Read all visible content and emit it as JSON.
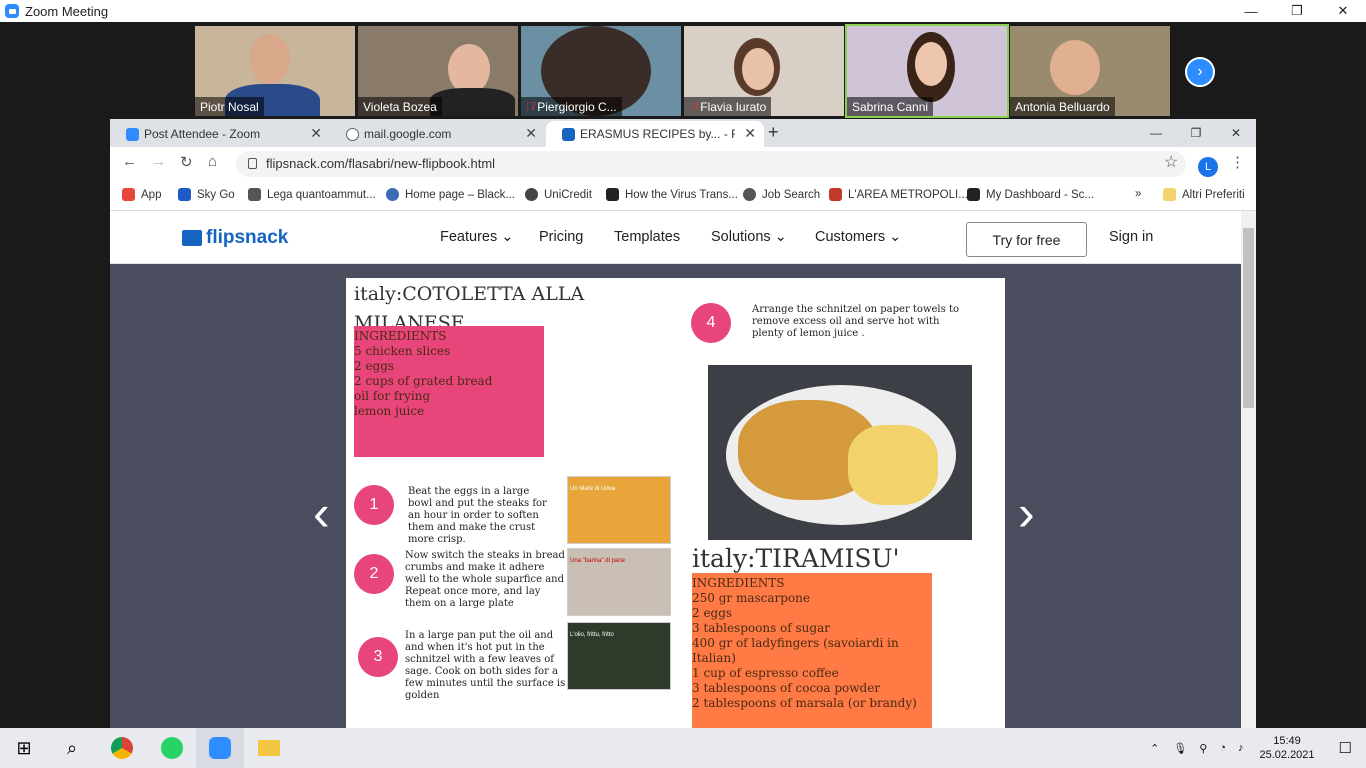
{
  "zoom": {
    "window_title": "Zoom Meeting",
    "controls": {
      "minimize": "—",
      "restore": "❐",
      "close": "✕"
    },
    "participants": [
      {
        "name": "Piotr Nosal",
        "muted": false
      },
      {
        "name": "Violeta Bozea",
        "muted": false
      },
      {
        "name": "Piergiorgio C...",
        "muted": true
      },
      {
        "name": "Flavia Iurato",
        "muted": true
      },
      {
        "name": "Sabrina Canni",
        "muted": false
      },
      {
        "name": "Antonia Belluardo",
        "muted": false
      }
    ],
    "next_icon": "›"
  },
  "browser": {
    "tabs": [
      {
        "title": "Post Attendee - Zoom",
        "color": "#2d8cff"
      },
      {
        "title": "mail.google.com",
        "color": "#5f6368"
      },
      {
        "title": "ERASMUS RECIPES by... - Flipsnac",
        "color": "#1565c0"
      }
    ],
    "new_tab": "+",
    "window_controls": {
      "minimize": "—",
      "restore": "❐",
      "close": "✕"
    },
    "url": "flipsnack.com/flasabri/new-flipbook.html",
    "profile_initial": "L",
    "bookmarks": [
      {
        "label": "App",
        "color": "#e8453c"
      },
      {
        "label": "Sky Go",
        "color": "#1e5bc6"
      },
      {
        "label": "Lega quantoammut...",
        "color": "#555"
      },
      {
        "label": "Home page – Black...",
        "color": "#3a6bb5"
      },
      {
        "label": "UniCredit",
        "color": "#444"
      },
      {
        "label": "How the Virus Trans...",
        "color": "#222"
      },
      {
        "label": "Job Search",
        "color": "#555"
      },
      {
        "label": "L'AREA METROPOLI...",
        "color": "#c0392b"
      },
      {
        "label": "My Dashboard - Sc...",
        "color": "#222"
      }
    ],
    "more": "»",
    "other_bookmarks": "Altri Preferiti"
  },
  "flipsnack": {
    "logo": "flipsnack",
    "nav": [
      "Features",
      "Pricing",
      "Templates",
      "Solutions",
      "Customers"
    ],
    "try_label": "Try for free",
    "sign_in": "Sign in"
  },
  "left_page": {
    "title": "italy:COTOLETTA ALLA MILANESE",
    "ingredients": [
      "INGREDIENTS",
      "5 chicken slices",
      "2 eggs",
      "2 cups of grated bread",
      "oil for frying",
      "lemon juice"
    ],
    "steps": [
      {
        "num": "1",
        "text": "Beat the eggs in a large bowl and put the steaks for an hour in order to soften them and make the crust more crisp."
      },
      {
        "num": "2",
        "text": "Now switch the steaks in bread crumbs and make it adhere well to the whole suparfice and Repeat once more, and lay them on a large plate"
      },
      {
        "num": "3",
        "text": "In a large pan put the oil and and when it's hot put in the schnitzel with a few leaves of sage. Cook on both sides for a few minutes until the surface is golden"
      }
    ],
    "image_captions": [
      "Un Mare di Uova",
      "Una \"barina\" di pane",
      "L'olio, frittu, fritto"
    ]
  },
  "right_page": {
    "step4": {
      "num": "4",
      "text": "Arrange the schnitzel on paper towels to remove excess oil and serve hot with plenty of lemon juice ."
    },
    "title": "italy:TIRAMISU'",
    "ingredients": [
      "INGREDIENTS",
      "250 gr mascarpone",
      "2 eggs",
      "3 tablespoons of sugar",
      "400 gr of ladyfingers (savoiardi in Italian)",
      "1 cup of espresso coffee",
      "3 tablespoons of  cocoa powder",
      "2 tablespoons of marsala (or brandy)"
    ]
  },
  "taskbar": {
    "time": "15:49",
    "date": "25.02.2021"
  },
  "colors": {
    "pink": "#e8457a",
    "orange": "#ff7a45",
    "zoom_blue": "#2d8cff",
    "viewer_bg": "#4a4d5e"
  }
}
